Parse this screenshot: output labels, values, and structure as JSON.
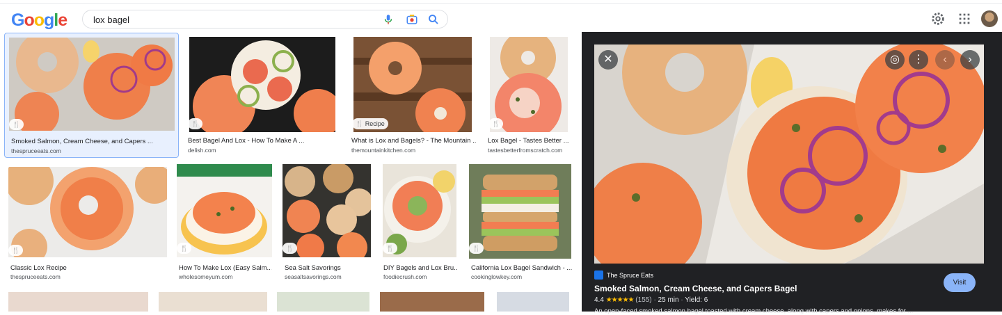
{
  "logo": {
    "letters": [
      "G",
      "o",
      "o",
      "g",
      "l",
      "e"
    ],
    "colors": [
      "#4285f4",
      "#ea4335",
      "#fbbc05",
      "#4285f4",
      "#34a853",
      "#ea4335"
    ]
  },
  "search": {
    "query": "lox bagel",
    "icons": [
      "microphone-icon",
      "camera-lens-icon",
      "search-icon"
    ]
  },
  "header_icons": [
    "gear-icon",
    "apps-grid-icon",
    "avatar"
  ],
  "results": [
    {
      "title": "Smoked Salmon, Cream Cheese, and Capers ...",
      "site": "thespruceeats.com",
      "tag": "",
      "tag_icon": "fork-knife-icon"
    },
    {
      "title": "Best Bagel And Lox - How To Make A ...",
      "site": "delish.com",
      "tag": "",
      "tag_icon": "fork-knife-icon"
    },
    {
      "title": "What is Lox and Bagels? - The Mountain ...",
      "site": "themountainkitchen.com",
      "tag": "Recipe",
      "tag_icon": "fork-knife-icon"
    },
    {
      "title": "Lox Bagel - Tastes Better ...",
      "site": "tastesbetterfromscratch.com",
      "tag": "",
      "tag_icon": "fork-knife-icon"
    },
    {
      "title": "Classic Lox Recipe",
      "site": "thespruceeats.com",
      "tag": "",
      "tag_icon": "fork-knife-icon"
    },
    {
      "title": "How To Make Lox (Easy Salm...",
      "site": "wholesomeyum.com",
      "tag": "",
      "tag_icon": "fork-knife-icon"
    },
    {
      "title": "Sea Salt Savorings",
      "site": "seasaltsavorings.com",
      "tag": "",
      "tag_icon": "fork-knife-icon"
    },
    {
      "title": "DIY Bagels and Lox Bru...",
      "site": "foodiecrush.com",
      "tag": "",
      "tag_icon": "fork-knife-icon"
    },
    {
      "title": "California Lox Bagel Sandwich - ...",
      "site": "cookinglowkey.com",
      "tag": "",
      "tag_icon": "fork-knife-icon"
    }
  ],
  "preview": {
    "source": "The Spruce Eats",
    "title": "Smoked Salmon, Cream Cheese, and Capers Bagel",
    "rating": "4.4",
    "stars": "★★★★★",
    "review_count": "(155)",
    "time": "25 min",
    "yield": "Yield: 6",
    "description": "An open-faced smoked salmon bagel toasted with cream cheese, along with capers and onions, makes for ...",
    "visit_label": "Visit",
    "buttons": [
      "close-icon",
      "lens-icon",
      "more-vert-icon",
      "prev-icon",
      "next-icon"
    ]
  },
  "colors": {
    "accent": "#1a73e8",
    "visit_bg": "#8ab4f8",
    "panel_bg": "#202124",
    "selected_bg": "#e8f0fe"
  }
}
